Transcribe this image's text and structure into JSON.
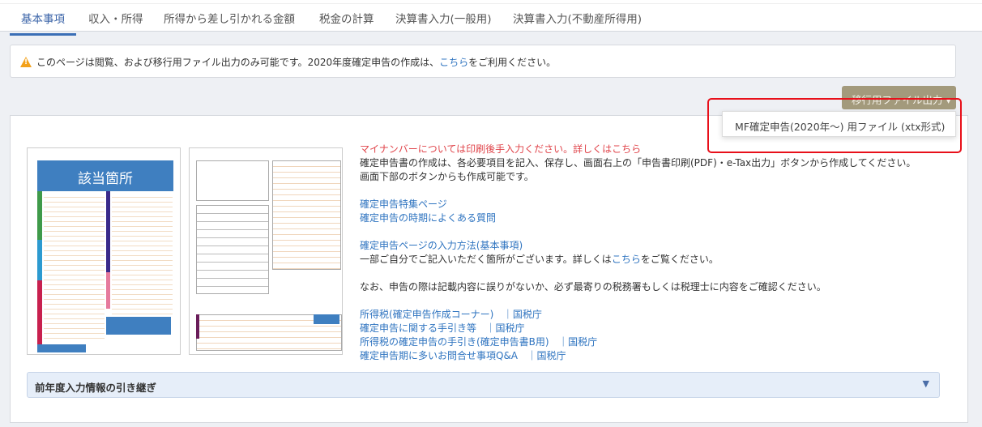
{
  "tabs": [
    {
      "label": "基本事項",
      "active": true
    },
    {
      "label": "収入・所得"
    },
    {
      "label": "所得から差し引かれる金額"
    },
    {
      "label": "税金の計算"
    },
    {
      "label": "決算書入力(一般用)"
    },
    {
      "label": "決算書入力(不動産所得用)"
    }
  ],
  "notice": {
    "icon": "warning-icon",
    "text": "このページは閲覧、および移行用ファイル出力のみ可能です。2020年度確定申告の作成は、",
    "link": "こちら",
    "suffix": "をご利用ください。"
  },
  "export": {
    "button": "移行用ファイル出力 ▾",
    "menu_item": "MF確定申告(2020年～) 用ファイル (xtx形式)",
    "highlight_color": "#e8101a"
  },
  "forms": {
    "label": "該当箇所"
  },
  "info": {
    "mynumber": "マイナンバーについては印刷後手入力ください。詳しくは",
    "mynumber_link": "こちら",
    "line1": "確定申告書の作成は、各必要項目を記入、保存し、画面右上の「申告書印刷(PDF)・e-Tax出力」ボタンから作成してください。",
    "line2": "画面下部のボタンからも作成可能です。",
    "link_special": "確定申告特集ページ",
    "link_faq": "確定申告の時期によくある質問",
    "link_howto": "確定申告ページの入力方法(基本事項)",
    "howto_text": "一部ご自分でご記入いただく箇所がございます。詳しくは",
    "howto_link": "こちら",
    "howto_suffix": "をご覧ください。",
    "caution": "なお、申告の際は記載内容に誤りがないか、必ず最寄りの税務署もしくは税理士に内容をご確認ください。",
    "refs": [
      {
        "label": "所得税(確定申告作成コーナー)",
        "source": "｜国税庁"
      },
      {
        "label": "確定申告に関する手引き等",
        "source": "｜国税庁"
      },
      {
        "label": "所得税の確定申告の手引き(確定申告書B用)",
        "source": "｜国税庁"
      },
      {
        "label": "確定申告期に多いお問合せ事項Q&A",
        "source": "｜国税庁"
      }
    ]
  },
  "accordion": {
    "label": "前年度入力情報の引き継ぎ"
  }
}
